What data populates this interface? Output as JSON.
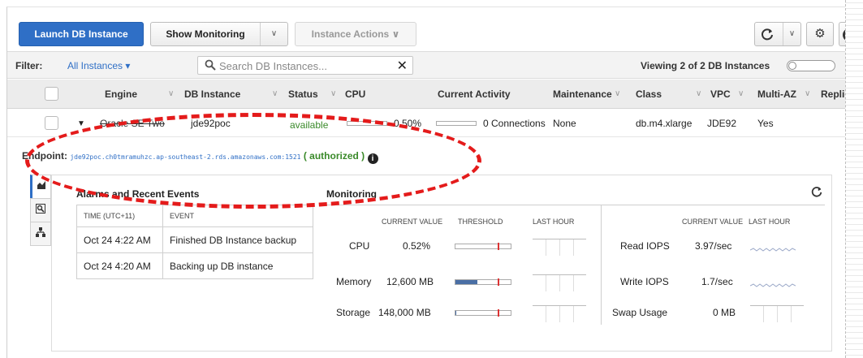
{
  "toolbar": {
    "launch_label": "Launch DB Instance",
    "monitoring_label": "Show Monitoring",
    "actions_label": "Instance Actions",
    "caret": "▾",
    "settings_icon": "gear-icon",
    "help_label": "?"
  },
  "filterbar": {
    "filter_label": "Filter:",
    "filter_value": "All Instances ▾",
    "search_placeholder": "Search DB Instances...",
    "clear_label": "✕",
    "viewing_text": "Viewing 2 of 2 DB Instances"
  },
  "table": {
    "columns": {
      "engine": "Engine",
      "db_instance": "DB Instance",
      "status": "Status",
      "cpu": "CPU",
      "activity": "Current Activity",
      "maintenance": "Maintenance",
      "class": "Class",
      "vpc": "VPC",
      "multiaz": "Multi-AZ",
      "replication": "Replic"
    },
    "row": {
      "engine": "Oracle SE Two",
      "db_instance": "jde92poc",
      "status": "available",
      "cpu": "0.50%",
      "activity": "0 Connections",
      "maintenance": "None",
      "class": "db.m4.xlarge",
      "vpc": "JDE92",
      "multiaz": "Yes"
    }
  },
  "endpoint": {
    "label": "Endpoint:",
    "value": "jde92poc.ch0tmramuhzc.ap-southeast-2.rds.amazonaws.com:1521",
    "auth": "( authorized )",
    "info": "i"
  },
  "alarms": {
    "title": "Alarms and Recent Events",
    "time_header": "TIME (UTC+11)",
    "event_header": "EVENT",
    "rows": [
      {
        "time": "Oct 24 4:22 AM",
        "event": "Finished DB Instance backup"
      },
      {
        "time": "Oct 24 4:20 AM",
        "event": "Backing up DB instance"
      }
    ]
  },
  "monitoring": {
    "title": "Monitoring",
    "headers": {
      "current_value": "CURRENT VALUE",
      "threshold": "THRESHOLD",
      "last_hour": "LAST HOUR",
      "current_value_2": "CURRENT VALUE",
      "last_hour_2": "LAST HOUR"
    },
    "left": [
      {
        "name": "CPU",
        "value": "0.52%",
        "fill": 0.0
      },
      {
        "name": "Memory",
        "value": "12,600 MB",
        "fill": 0.4
      },
      {
        "name": "Storage",
        "value": "148,000 MB",
        "fill": 0.02
      }
    ],
    "right": [
      {
        "name": "Read IOPS",
        "value": "3.97/sec"
      },
      {
        "name": "Write IOPS",
        "value": "1.7/sec"
      },
      {
        "name": "Swap Usage",
        "value": "0 MB"
      }
    ]
  },
  "annotation": {
    "color": "#e41b1b"
  }
}
